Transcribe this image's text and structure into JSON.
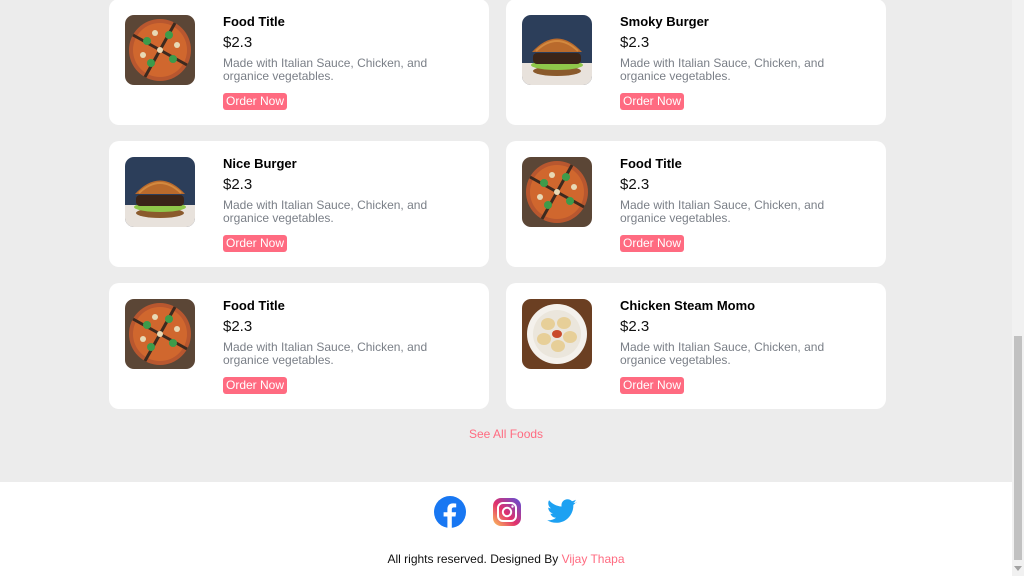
{
  "foods": [
    {
      "title": "Food Title",
      "price": "$2.3",
      "description": "Made with Italian Sauce, Chicken, and organice vegetables.",
      "button_label": "Order Now",
      "image": "pizza"
    },
    {
      "title": "Smoky Burger",
      "price": "$2.3",
      "description": "Made with Italian Sauce, Chicken, and organice vegetables.",
      "button_label": "Order Now",
      "image": "burger"
    },
    {
      "title": "Nice Burger",
      "price": "$2.3",
      "description": "Made with Italian Sauce, Chicken, and organice vegetables.",
      "button_label": "Order Now",
      "image": "burger"
    },
    {
      "title": "Food Title",
      "price": "$2.3",
      "description": "Made with Italian Sauce, Chicken, and organice vegetables.",
      "button_label": "Order Now",
      "image": "pizza"
    },
    {
      "title": "Food Title",
      "price": "$2.3",
      "description": "Made with Italian Sauce, Chicken, and organice vegetables.",
      "button_label": "Order Now",
      "image": "pizza"
    },
    {
      "title": "Chicken Steam Momo",
      "price": "$2.3",
      "description": "Made with Italian Sauce, Chicken, and organice vegetables.",
      "button_label": "Order Now",
      "image": "momo"
    }
  ],
  "see_all_label": "See All Foods",
  "footer": {
    "social": [
      "facebook-icon",
      "instagram-icon",
      "twitter-icon"
    ],
    "credits_prefix": "All rights reserved. Designed By ",
    "credits_author": "Vijay Thapa"
  },
  "colors": {
    "accent": "#ff6b81",
    "page_bg": "#ececec",
    "card_bg": "#ffffff",
    "description": "#7a7f87",
    "facebook": "#1877f2",
    "twitter": "#1da1f2"
  }
}
